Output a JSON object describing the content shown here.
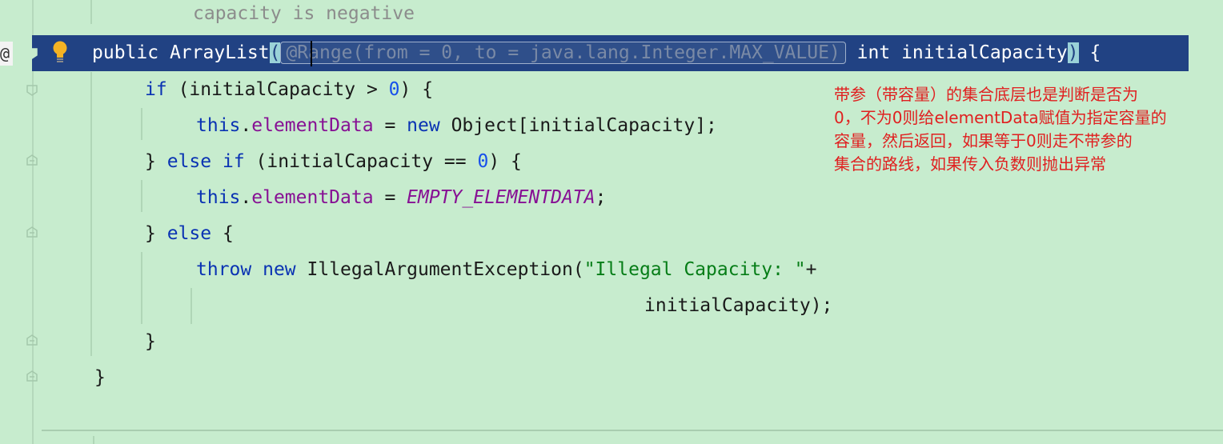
{
  "editor": {
    "gutter_marker": "@",
    "icons": [
      "implements-marker-icon",
      "lightbulb-icon",
      "fold-marker-icon"
    ],
    "colors": {
      "background": "#c7ecce",
      "selection": "#214283",
      "keyword": "#0a33b3",
      "field": "#871094",
      "string": "#067d17",
      "note": "#e02020"
    }
  },
  "code": {
    "doc_tail": "capacity is negative",
    "l1_public": "public",
    "l1_name": "ArrayList",
    "l1_paren_open": "(",
    "l1_annotation": "@Range(from = 0, to = java.lang.Integer.MAX_VALUE)",
    "l1_type": "int",
    "l1_param": "initialCapacity",
    "l1_paren_close": ")",
    "l1_brace": "{",
    "l2_if": "if",
    "l2_cond_a": "(initialCapacity >",
    "l2_zero": "0",
    "l2_cond_b": ") {",
    "l3_this": "this",
    "l3_dot": ".",
    "l3_field": "elementData",
    "l3_eq": "=",
    "l3_new": "new",
    "l3_rest": "Object[initialCapacity];",
    "l4_close": "}",
    "l4_else": "else",
    "l4_if": "if",
    "l4_cond_a": "(initialCapacity ==",
    "l4_zero": "0",
    "l4_cond_b": ") {",
    "l5_this": "this",
    "l5_dot": ".",
    "l5_field": "elementData",
    "l5_eq": "=",
    "l5_const": "EMPTY_ELEMENTDATA",
    "l5_semi": ";",
    "l6_close": "}",
    "l6_else": "else",
    "l6_brace": "{",
    "l7_throw": "throw",
    "l7_new": "new",
    "l7_class": "IllegalArgumentException(",
    "l7_string": "\"Illegal Capacity: \"",
    "l7_plus": "+",
    "l8_arg": "initialCapacity);",
    "l9_close": "}",
    "l10_close": "}"
  },
  "annotation_note": {
    "lines": [
      "带参（带容量）的集合底层也是判断是否为",
      "0，不为0则给elementData赋值为指定容量的",
      "容量，然后返回，如果等于0则走不带参的",
      "集合的路线，如果传入负数则抛出异常"
    ]
  }
}
